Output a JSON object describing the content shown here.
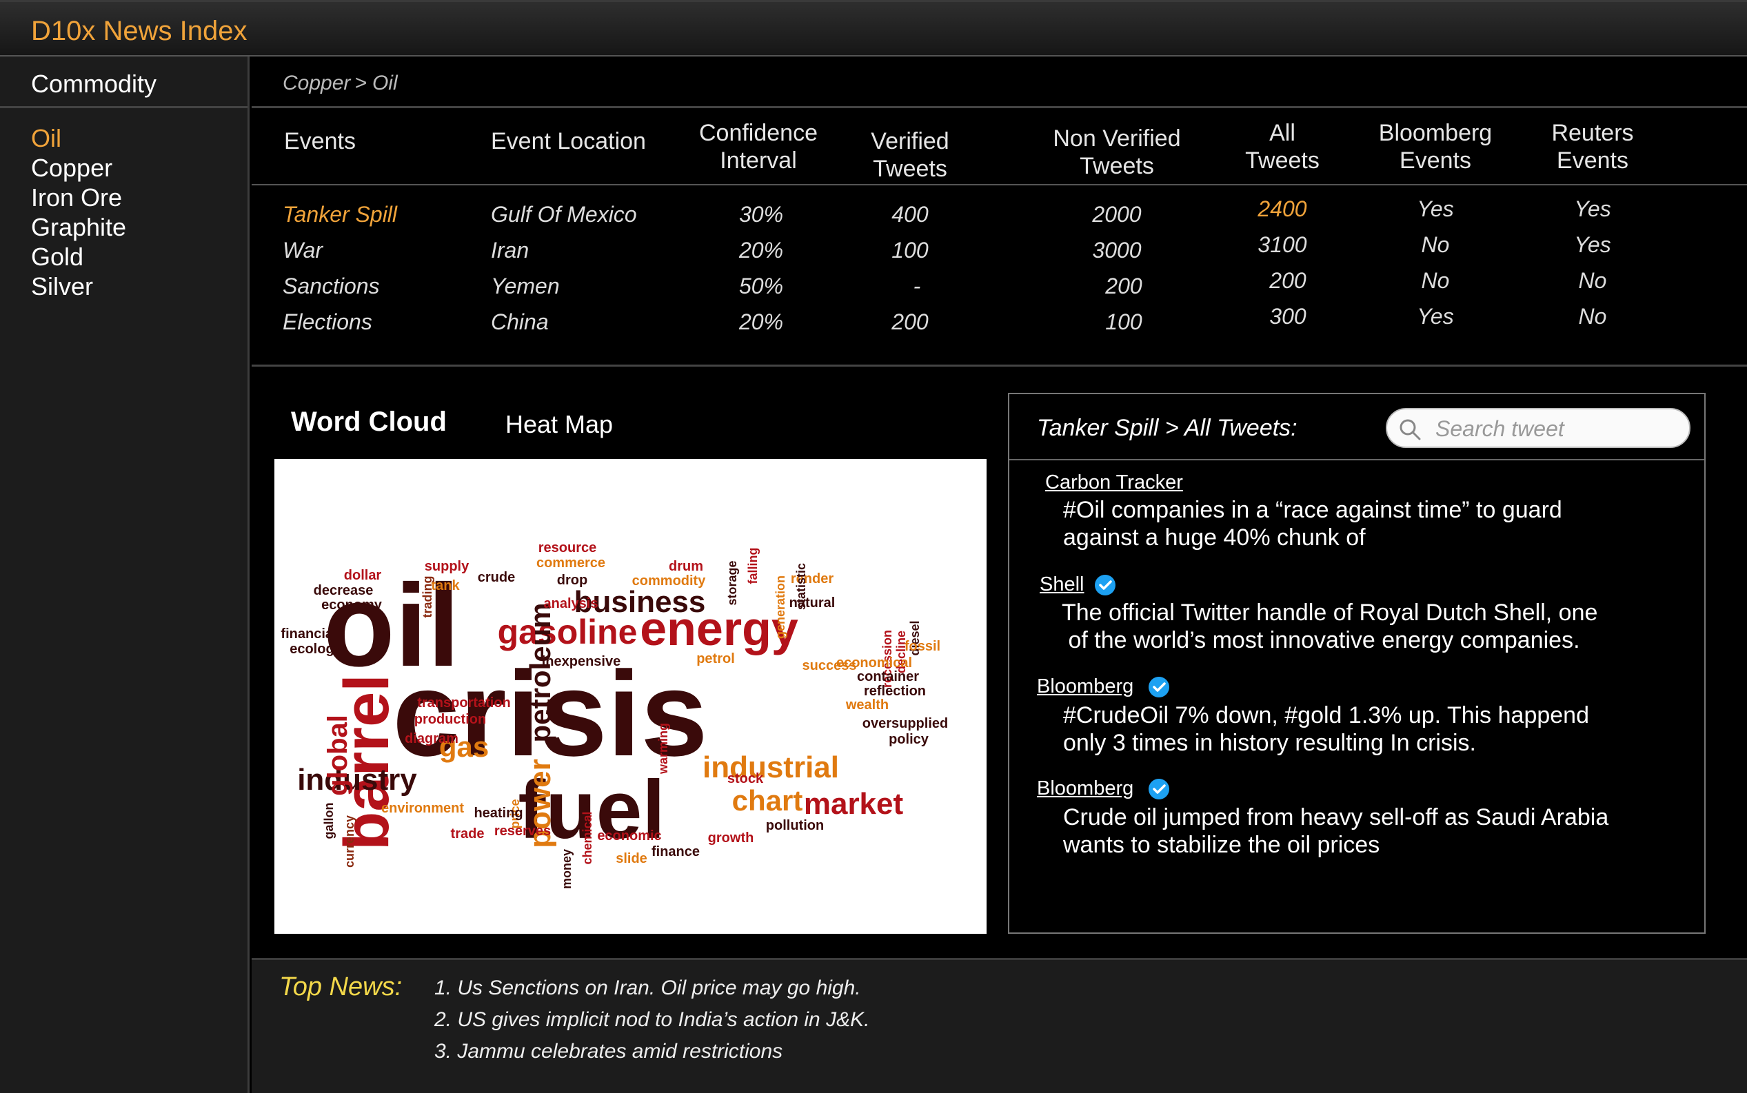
{
  "app": {
    "title": "D10x News Index"
  },
  "sidebar": {
    "heading": "Commodity",
    "items": [
      {
        "label": "Oil",
        "active": true
      },
      {
        "label": "Copper"
      },
      {
        "label": "Iron Ore"
      },
      {
        "label": "Graphite"
      },
      {
        "label": "Gold"
      },
      {
        "label": "Silver"
      }
    ]
  },
  "breadcrumb": {
    "parent": "Copper",
    "separator": ">",
    "current": "Oil"
  },
  "table": {
    "headers": {
      "events": "Events",
      "location": "Event Location",
      "confidence_1": "Confidence",
      "confidence_2": "Interval",
      "verified_1": "Verified",
      "verified_2": "Tweets",
      "nonverified_1": "Non Verified",
      "nonverified_2": "Tweets",
      "all_1": "All",
      "all_2": "Tweets",
      "bloomberg_1": "Bloomberg",
      "bloomberg_2": "Events",
      "reuters_1": "Reuters",
      "reuters_2": "Events"
    },
    "rows": [
      {
        "event": "Tanker Spill",
        "location": "Gulf Of Mexico",
        "confidence": "30%",
        "verified": "400",
        "non_verified": "2000",
        "all": "2400",
        "bloomberg": "Yes",
        "reuters": "Yes"
      },
      {
        "event": "War",
        "location": "Iran",
        "confidence": "20%",
        "verified": "100",
        "non_verified": "3000",
        "all": "3100",
        "bloomberg": "No",
        "reuters": "Yes"
      },
      {
        "event": "Sanctions",
        "location": "Yemen",
        "confidence": "50%",
        "verified": "-",
        "non_verified": "200",
        "all": "200",
        "bloomberg": "No",
        "reuters": "No"
      },
      {
        "event": "Elections",
        "location": "China",
        "confidence": "20%",
        "verified": "200",
        "non_verified": "100",
        "all": "300",
        "bloomberg": "Yes",
        "reuters": "No"
      }
    ]
  },
  "tabs": {
    "word_cloud": "Word Cloud",
    "heat_map": "Heat Map"
  },
  "word_cloud": {
    "words": [
      "oil",
      "crisis",
      "fuel",
      "barrel",
      "energy",
      "gasoline",
      "business",
      "petroleum",
      "industry",
      "industrial",
      "market",
      "chart",
      "gas",
      "power",
      "global",
      "dollar",
      "decrease",
      "economy",
      "supply",
      "tank",
      "crude",
      "trading",
      "resource",
      "commerce",
      "drop",
      "commodity",
      "analysis",
      "storage",
      "falling",
      "generation",
      "drum",
      "render",
      "natural",
      "statistic",
      "recession",
      "decline",
      "diesel",
      "fossil",
      "economical",
      "success",
      "petrol",
      "inexpensive",
      "container",
      "reflection",
      "wealth",
      "oversupplied",
      "policy",
      "financial",
      "ecology",
      "transportation",
      "production",
      "diagram",
      "gallon",
      "currency",
      "price",
      "environment",
      "heating",
      "trade",
      "reserves",
      "money",
      "chemical",
      "economic",
      "slide",
      "finance",
      "growth",
      "stock",
      "pollution",
      "warming"
    ]
  },
  "tweets": {
    "title": "Tanker Spill > All Tweets:",
    "search_placeholder": "Search tweet",
    "items": [
      {
        "author": "Carbon Tracker",
        "verified": false,
        "line1": "#Oil companies in a “race against time” to guard",
        "line2": "against a huge 40% chunk of"
      },
      {
        "author": "Shell",
        "verified": true,
        "line1": "The official Twitter handle of Royal Dutch Shell, one",
        "line2": " of the world’s most innovative energy companies."
      },
      {
        "author": "Bloomberg",
        "verified": true,
        "line1": "#CrudeOil 7% down, #gold 1.3% up. This happend",
        "line2": "only 3 times in history resulting In crisis."
      },
      {
        "author": "Bloomberg",
        "verified": true,
        "line1": "Crude oil jumped from heavy sell-off as Saudi Arabia",
        "line2": "wants to stabilize the oil prices"
      }
    ]
  },
  "top_news": {
    "label": "Top News:",
    "items": [
      "1. Us Senctions on Iran. Oil price may go high.",
      "2. US gives implicit nod to India’s action in J&K.",
      "3. Jammu celebrates amid restrictions"
    ]
  },
  "colors": {
    "accent": "#f0a33a",
    "top_news_label": "#f3d84a",
    "verified": "#1da1f2"
  },
  "icons": {
    "search": "search-icon",
    "verified": "verified-badge-icon"
  }
}
